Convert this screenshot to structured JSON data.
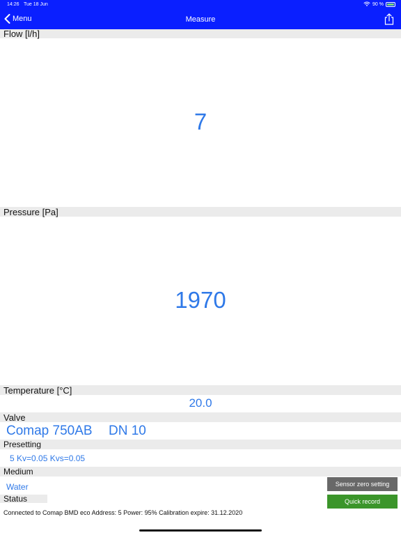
{
  "status_bar": {
    "time": "14:26",
    "date": "Tue 18 Jun",
    "battery_percent": "90 %"
  },
  "nav": {
    "back_label": "Menu",
    "title": "Measure"
  },
  "flow": {
    "label": "Flow [l/h]",
    "value": "7"
  },
  "pressure": {
    "label": "Pressure [Pa]",
    "value": "1970"
  },
  "temperature": {
    "label": "Temperature [°C]",
    "value": "20.0"
  },
  "valve": {
    "label": "Valve",
    "model": "Comap 750AB",
    "size": "DN 10"
  },
  "presetting": {
    "label": "Presetting",
    "value": "5 Kv=0.05 Kvs=0.05"
  },
  "medium": {
    "label": "Medium",
    "value": "Water"
  },
  "status": {
    "label": "Status",
    "text": "Connected to Comap BMD eco Address: 5 Power: 95% Calibration expire: 31.12.2020"
  },
  "buttons": {
    "sensor_zero": "Sensor zero setting",
    "quick_record": "Quick record"
  },
  "colors": {
    "nav_background": "#0a1fff",
    "value_blue": "#2f79e8",
    "section_gray": "#ebebeb",
    "sensor_button": "#686868",
    "record_button": "#3b952a"
  }
}
